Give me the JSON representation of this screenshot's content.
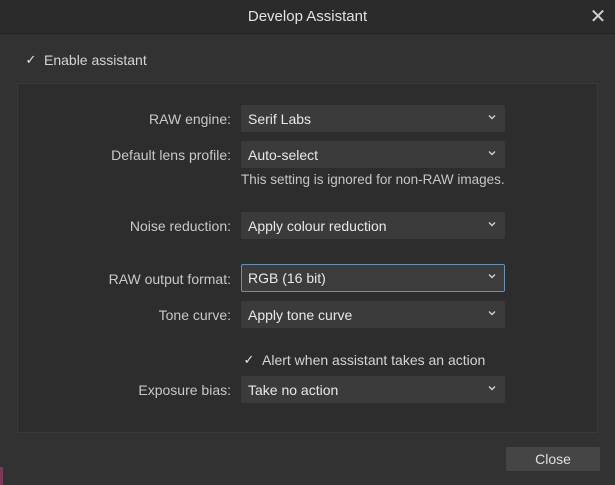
{
  "window": {
    "title": "Develop Assistant",
    "close_glyph": "✕"
  },
  "enable": {
    "checked": true,
    "label": "Enable assistant"
  },
  "fields": {
    "raw_engine": {
      "label": "RAW engine:",
      "value": "Serif Labs"
    },
    "lens_profile": {
      "label": "Default lens profile:",
      "value": "Auto-select"
    },
    "lens_note": "This setting is ignored for non-RAW images.",
    "noise_reduction": {
      "label": "Noise reduction:",
      "value": "Apply colour reduction"
    },
    "raw_output": {
      "label": "RAW output format:",
      "value": "RGB (16 bit)"
    },
    "tone_curve": {
      "label": "Tone curve:",
      "value": "Apply tone curve"
    },
    "alert": {
      "checked": true,
      "label": "Alert when assistant takes an action"
    },
    "exposure_bias": {
      "label": "Exposure bias:",
      "value": "Take no action"
    }
  },
  "footer": {
    "close_label": "Close"
  },
  "colors": {
    "background": "#323232",
    "panel": "#2d2d2d",
    "dropdown": "#3b3b3b",
    "focus_border": "#6c8fb6",
    "button": "#454545"
  },
  "icons": {
    "check": "checkmark-icon",
    "dropdown": "chevron-down-icon",
    "close": "close-icon"
  }
}
